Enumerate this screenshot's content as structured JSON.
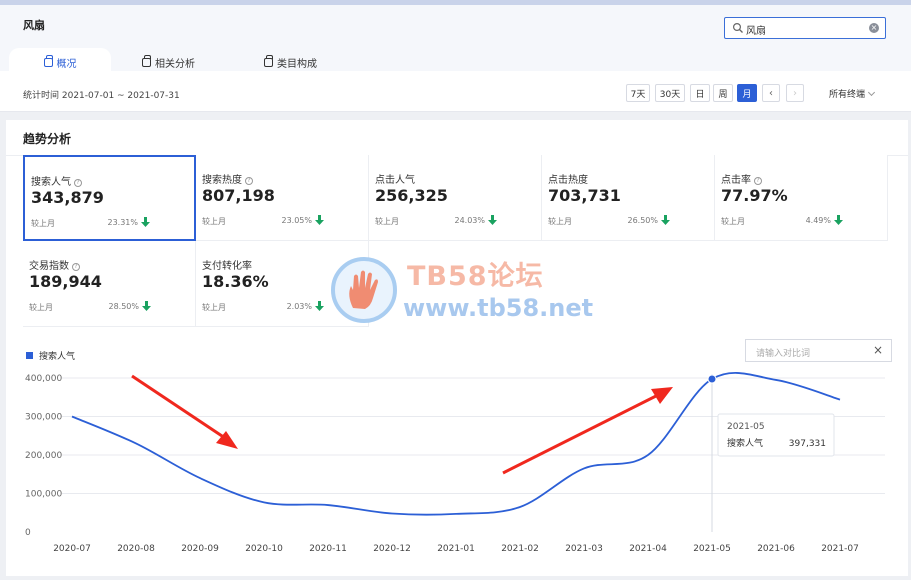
{
  "header": {
    "title": "风扇",
    "search_value": "风扇"
  },
  "tabs": [
    {
      "label": "概况",
      "active": true
    },
    {
      "label": "相关分析",
      "active": false
    },
    {
      "label": "类目构成",
      "active": false
    }
  ],
  "filter": {
    "period_text": "统计时间 2021-07-01 ~ 2021-07-31",
    "buttons": [
      "7天",
      "30天",
      "日",
      "周",
      "月"
    ],
    "active_button": "月",
    "terminal": "所有终端"
  },
  "panel": {
    "title": "趋势分析"
  },
  "metrics": [
    {
      "label": "搜索人气",
      "help": true,
      "value": "343,879",
      "compare_label": "较上月",
      "change": "23.31%",
      "direction": "down",
      "selected": true
    },
    {
      "label": "搜索热度",
      "help": true,
      "value": "807,198",
      "compare_label": "较上月",
      "change": "23.05%",
      "direction": "down",
      "selected": false
    },
    {
      "label": "点击人气",
      "help": false,
      "value": "256,325",
      "compare_label": "较上月",
      "change": "24.03%",
      "direction": "down",
      "selected": false
    },
    {
      "label": "点击热度",
      "help": false,
      "value": "703,731",
      "compare_label": "较上月",
      "change": "26.50%",
      "direction": "down",
      "selected": false
    },
    {
      "label": "点击率",
      "help": true,
      "value": "77.97%",
      "compare_label": "较上月",
      "change": "4.49%",
      "direction": "down",
      "selected": false
    },
    {
      "label": "交易指数",
      "help": true,
      "value": "189,944",
      "compare_label": "较上月",
      "change": "28.50%",
      "direction": "down",
      "selected": false
    },
    {
      "label": "支付转化率",
      "help": false,
      "value": "18.36%",
      "compare_label": "较上月",
      "change": "2.03%",
      "direction": "down",
      "selected": false
    }
  ],
  "compare_input": {
    "placeholder": "请输入对比词"
  },
  "colors": {
    "accent": "#2c5fd6",
    "down_arrow": "#1aa260",
    "annotation_arrow": "#f0281e"
  },
  "watermark": {
    "brand": "TB58论坛",
    "url": "www.tb58.net"
  },
  "chart_data": {
    "type": "line",
    "categories": [
      "2020-07",
      "2020-08",
      "2020-09",
      "2020-10",
      "2020-11",
      "2020-12",
      "2021-01",
      "2021-02",
      "2021-03",
      "2021-04",
      "2021-05",
      "2021-06",
      "2021-07"
    ],
    "series": [
      {
        "name": "搜索人气",
        "values": [
          300000,
          230000,
          140000,
          77000,
          70000,
          48000,
          47000,
          65000,
          165000,
          200000,
          397331,
          395000,
          343879
        ]
      }
    ],
    "ylim": [
      0,
      400000
    ],
    "yticks": [
      "0",
      "100,000",
      "200,000",
      "300,000",
      "400,000"
    ],
    "grid": true,
    "legend": "top-left",
    "tooltip": {
      "date": "2021-05",
      "label": "搜索人气",
      "value": "397,331"
    }
  }
}
